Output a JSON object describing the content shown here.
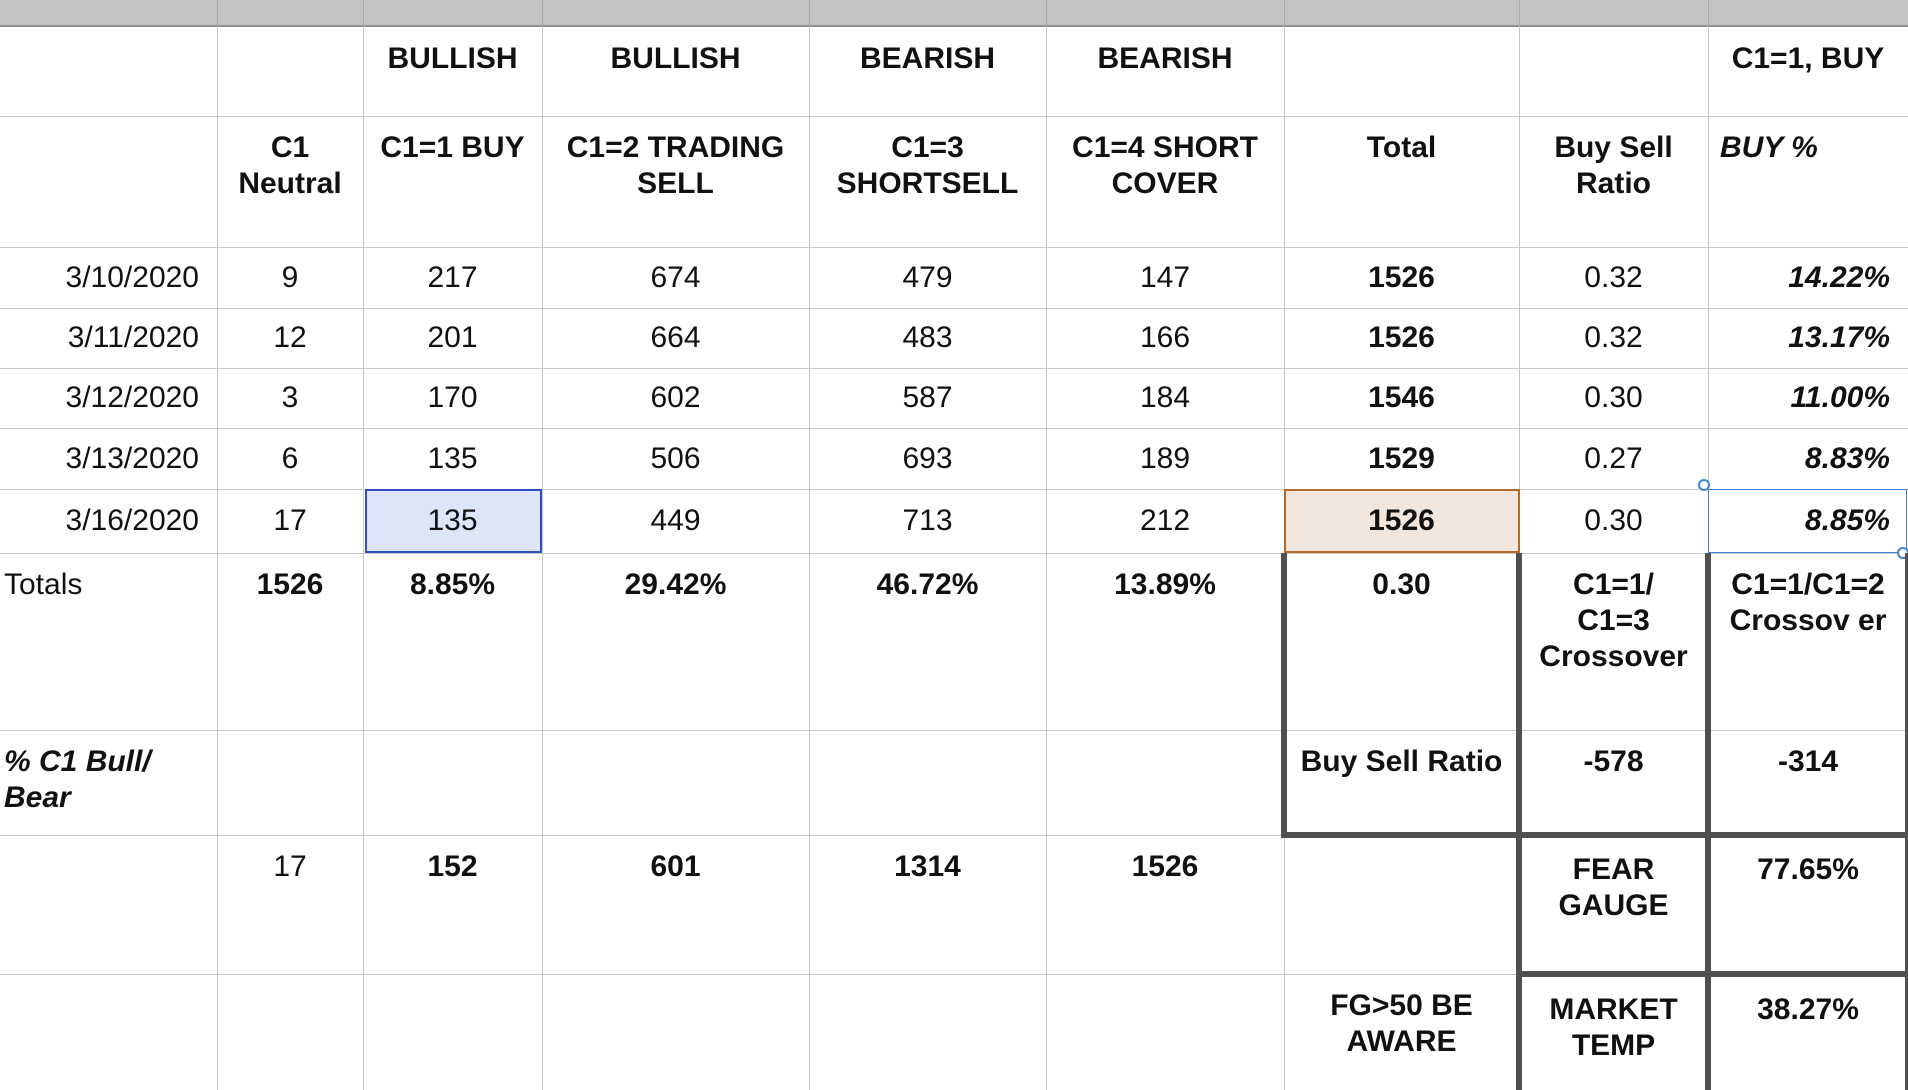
{
  "group_headers": {
    "buy": "BULLISH",
    "trading_sell": "BULLISH",
    "shortsell": "BEARISH",
    "short_cover": "BEARISH",
    "buy_pct": "C1=1, BUY"
  },
  "column_headers": {
    "neutral": "C1\nNeutral",
    "buy": "C1=1 BUY",
    "trading_sell": "C1=2 TRADING\nSELL",
    "shortsell": "C1=3\nSHORTSELL",
    "short_cover": "C1=4 SHORT\nCOVER",
    "total": "Total",
    "ratio": "Buy Sell\nRatio",
    "buy_pct": "BUY %"
  },
  "rows": [
    {
      "date": "3/10/2020",
      "neutral": "9",
      "buy": "217",
      "trading_sell": "674",
      "shortsell": "479",
      "short_cover": "147",
      "total": "1526",
      "ratio": "0.32",
      "buy_pct": "14.22%"
    },
    {
      "date": "3/11/2020",
      "neutral": "12",
      "buy": "201",
      "trading_sell": "664",
      "shortsell": "483",
      "short_cover": "166",
      "total": "1526",
      "ratio": "0.32",
      "buy_pct": "13.17%"
    },
    {
      "date": "3/12/2020",
      "neutral": "3",
      "buy": "170",
      "trading_sell": "602",
      "shortsell": "587",
      "short_cover": "184",
      "total": "1546",
      "ratio": "0.30",
      "buy_pct": "11.00%"
    },
    {
      "date": "3/13/2020",
      "neutral": "6",
      "buy": "135",
      "trading_sell": "506",
      "shortsell": "693",
      "short_cover": "189",
      "total": "1529",
      "ratio": "0.27",
      "buy_pct": "8.83%"
    },
    {
      "date": "3/16/2020",
      "neutral": "17",
      "buy": "135",
      "trading_sell": "449",
      "shortsell": "713",
      "short_cover": "212",
      "total": "1526",
      "ratio": "0.30",
      "buy_pct": "8.85%"
    }
  ],
  "totals": {
    "label": "Totals",
    "neutral": "1526",
    "buy": "8.85%",
    "trading_sell": "29.42%",
    "shortsell": "46.72%",
    "short_cover": "13.89%",
    "total": "0.30",
    "ratio": "C1=1/\nC1=3\nCrossover",
    "buy_pct": "C1=1/C1=2\nCrossov er"
  },
  "bull_bear": {
    "label": "% C1 Bull/\nBear",
    "total": "Buy Sell Ratio",
    "ratio": "-578",
    "buy_pct": "-314"
  },
  "cumulative": {
    "neutral": "17",
    "buy": "152",
    "trading_sell": "601",
    "shortsell": "1314",
    "short_cover": "1526",
    "ratio": "FEAR\nGAUGE",
    "buy_pct": "77.65%"
  },
  "market": {
    "total": "FG>50 BE\nAWARE",
    "ratio": "MARKET\nTEMP",
    "buy_pct": "38.27%"
  },
  "colors": {
    "selection_blue": "#2f4fc2",
    "selection_fill": "#dfe5f8",
    "total_fill": "#f2e5dc",
    "total_border": "#b46a2c",
    "thick_border": "#505050"
  }
}
